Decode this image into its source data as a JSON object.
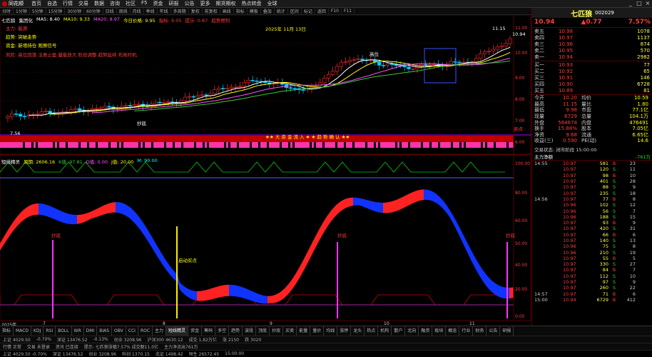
{
  "app": {
    "logo_text": "同花顺",
    "menus": [
      "首页",
      "自选",
      "行情",
      "交易",
      "数据",
      "咨询",
      "社区",
      "F5",
      "资金",
      "研报",
      "公告",
      "更多",
      "期货期权",
      "热点转盘",
      "全球"
    ],
    "window_controls": [
      "_",
      "□",
      "×"
    ]
  },
  "toolbar": {
    "items": [
      "分时",
      "1分钟",
      "5分钟",
      "15分钟",
      "30分钟",
      "60分钟",
      "日线",
      "周线",
      "月线",
      "季线",
      "年线",
      "多周期",
      "复权",
      "前复权",
      "画线",
      "指标",
      "模板",
      "叠加",
      "统计",
      "区间",
      "标记",
      "返回",
      "F10",
      "F11"
    ]
  },
  "main": {
    "legend_main": {
      "label_a": "七匹狼",
      "label_b": "集团化",
      "ma5": "MA5: 8.40",
      "ma10": "MA10: 9.33",
      "ma20": "MA20: 8.97",
      "extra": "今日价格: 9.95",
      "hint": "指标: 9.05",
      "warn": "提示: 0.87",
      "tag": "趋势预判"
    },
    "annotations": {
      "line1": "主力: 能源",
      "line2": "趋势: 突破走势",
      "line3": "资金: 新增持仓  观察信号",
      "line4": "风险: 高位回落 注意止盈 量能放大 阶段调整 趋势延续 布局时机",
      "date_label": "2025年 11月 13日",
      "high_marker": "高位",
      "low_marker": "7.56",
      "high_price": "11.15",
      "right_price": "10.94",
      "buy_label": "抄底",
      "sell_label": "卖点",
      "signal_line": "★★ 大 资 金 流 入 ★  ★ 趋 势 确 认 ★★",
      "ytick_top": "11.00",
      "ytick_labels": [
        "11.00",
        "10.00",
        "9.00",
        "8.00",
        "7.00",
        "6.00"
      ]
    },
    "legend_osc": {
      "name": "短线精灵",
      "v1": "周期: 2606.16",
      "v2": "K值: 97.81",
      "v3": "D值: 0.00",
      "v4": "J值: 20.00",
      "v5": "M: 90.00"
    },
    "osc_labels": {
      "buy1": "抄底",
      "yellow_note": "启动买点",
      "buy2": "抄底",
      "buy3": "抄底",
      "ytick_labels": [
        "100.00",
        "80.00",
        "60.00",
        "50.00",
        "40.00",
        "20.00",
        "0.00"
      ]
    },
    "xaxis_labels": [
      "2025年",
      "7",
      "8",
      "9",
      "10",
      "11"
    ]
  },
  "sidebar": {
    "stock_name": "七匹狼",
    "stock_code": "002029",
    "price": "10.94",
    "change": "▲0.77",
    "pct": "7.57%",
    "asks": [
      {
        "label": "卖五",
        "price": "10.98",
        "vol": "1078"
      },
      {
        "label": "卖四",
        "price": "10.97",
        "vol": "1137"
      },
      {
        "label": "卖三",
        "price": "10.96",
        "vol": "874"
      },
      {
        "label": "卖二",
        "price": "10.95",
        "vol": "570"
      },
      {
        "label": "卖一",
        "price": "10.94",
        "vol": "2982"
      }
    ],
    "bids": [
      {
        "label": "买一",
        "price": "10.93",
        "vol": "77"
      },
      {
        "label": "买二",
        "price": "10.92",
        "vol": "65"
      },
      {
        "label": "买三",
        "price": "10.91",
        "vol": "146"
      },
      {
        "label": "买四",
        "price": "10.90",
        "vol": "6728"
      },
      {
        "label": "买五",
        "price": "10.89",
        "vol": "81"
      }
    ],
    "stats": [
      {
        "a": "今开",
        "b": "10.20",
        "c": "均价",
        "d": "10.59"
      },
      {
        "a": "最高",
        "b": "11.15",
        "c": "量比",
        "d": "1.80"
      },
      {
        "a": "最低",
        "b": "9.98",
        "c": "市盈",
        "d": "77.1亿"
      },
      {
        "a": "现量",
        "b": "6729",
        "c": "总量",
        "d": "104.1万"
      },
      {
        "a": "外盘",
        "b": "564674",
        "c": "内盘",
        "d": "476491"
      },
      {
        "a": "换手",
        "b": "15.88%",
        "c": "股本",
        "d": "7.05亿"
      },
      {
        "a": "净资",
        "b": "9.68",
        "c": "流通",
        "d": "6.65亿"
      },
      {
        "a": "收益(三)",
        "b": "0.590",
        "c": "PE(动)",
        "d": "14.6"
      }
    ],
    "status_line": "交易状态: 闭市阶段 15:00:00",
    "indicator_line": "主力净额",
    "indicator_val": "-761万",
    "trades": [
      {
        "t": "14:55",
        "p": "10.97",
        "v": "581",
        "f": "B",
        "n": "23"
      },
      {
        "t": "",
        "p": "10.97",
        "v": "120",
        "f": "S",
        "n": "11"
      },
      {
        "t": "",
        "p": "10.97",
        "v": "98",
        "f": "B",
        "n": "10"
      },
      {
        "t": "",
        "p": "10.97",
        "v": "401",
        "f": "S",
        "n": "28"
      },
      {
        "t": "",
        "p": "10.97",
        "v": "88",
        "f": "S",
        "n": "9"
      },
      {
        "t": "",
        "p": "10.97",
        "v": "235",
        "f": "S",
        "n": "18"
      },
      {
        "t": "14:56",
        "p": "10.97",
        "v": "77",
        "f": "B",
        "n": "8"
      },
      {
        "t": "",
        "p": "10.96",
        "v": "102",
        "f": "S",
        "n": "12"
      },
      {
        "t": "",
        "p": "10.96",
        "v": "56",
        "f": "S",
        "n": "7"
      },
      {
        "t": "",
        "p": "10.96",
        "v": "188",
        "f": "S",
        "n": "15"
      },
      {
        "t": "",
        "p": "10.97",
        "v": "93",
        "f": "B",
        "n": "9"
      },
      {
        "t": "",
        "p": "10.97",
        "v": "420",
        "f": "S",
        "n": "31"
      },
      {
        "t": "",
        "p": "10.97",
        "v": "66",
        "f": "B",
        "n": "6"
      },
      {
        "t": "",
        "p": "10.97",
        "v": "140",
        "f": "S",
        "n": "13"
      },
      {
        "t": "",
        "p": "10.96",
        "v": "75",
        "f": "S",
        "n": "8"
      },
      {
        "t": "",
        "p": "10.96",
        "v": "210",
        "f": "S",
        "n": "19"
      },
      {
        "t": "",
        "p": "10.97",
        "v": "55",
        "f": "B",
        "n": "5"
      },
      {
        "t": "",
        "p": "10.97",
        "v": "330",
        "f": "S",
        "n": "27"
      },
      {
        "t": "",
        "p": "10.97",
        "v": "84",
        "f": "B",
        "n": "7"
      },
      {
        "t": "",
        "p": "10.97",
        "v": "112",
        "f": "S",
        "n": "10"
      },
      {
        "t": "",
        "p": "10.97",
        "v": "97",
        "f": "S",
        "n": "9"
      },
      {
        "t": "",
        "p": "10.97",
        "v": "260",
        "f": "S",
        "n": "22"
      },
      {
        "t": "14:57",
        "p": "10.97",
        "v": "71",
        "f": "B",
        "n": "6"
      },
      {
        "t": "15:00",
        "p": "10.94",
        "v": "6729",
        "f": "B",
        "n": "412"
      }
    ]
  },
  "tabs": [
    "指标",
    "MACD",
    "KDJ",
    "RSI",
    "BOLL",
    "WR",
    "DMI",
    "BIAS",
    "OBV",
    "CCI",
    "ROC",
    "主力",
    "短线精灵",
    "资金",
    "筹码",
    "多空",
    "趋势",
    "波段",
    "顶底",
    "抄底",
    "买卖",
    "能量",
    "量价",
    "均线",
    "涨停",
    "龙头",
    "热点",
    "机构",
    "散户",
    "北向",
    "融资",
    "板块",
    "概念",
    "行业",
    "财务",
    "公告",
    "研报"
  ],
  "status": {
    "line1": [
      "上证 4029.50",
      "-0.70%",
      "深证 13476.52",
      "-0.13%",
      "创业 3208.96",
      "沪深300 4630.12",
      "成交 1.82万亿",
      "涨 2150",
      "跌 3020"
    ],
    "line2": [
      "行情 正常",
      "交易 未登录",
      "资讯 已连接",
      "提示: 七匹狼涨幅7.57% 成交额11.0亿",
      "主力净流出761万"
    ],
    "line3": [
      "上证 4029.50 -0.70%",
      "深证 13476.52",
      "创业 3208.96",
      "科创 1370.15",
      "北证 1498.42",
      "恒生 26572.45",
      "15:00:00"
    ]
  }
}
